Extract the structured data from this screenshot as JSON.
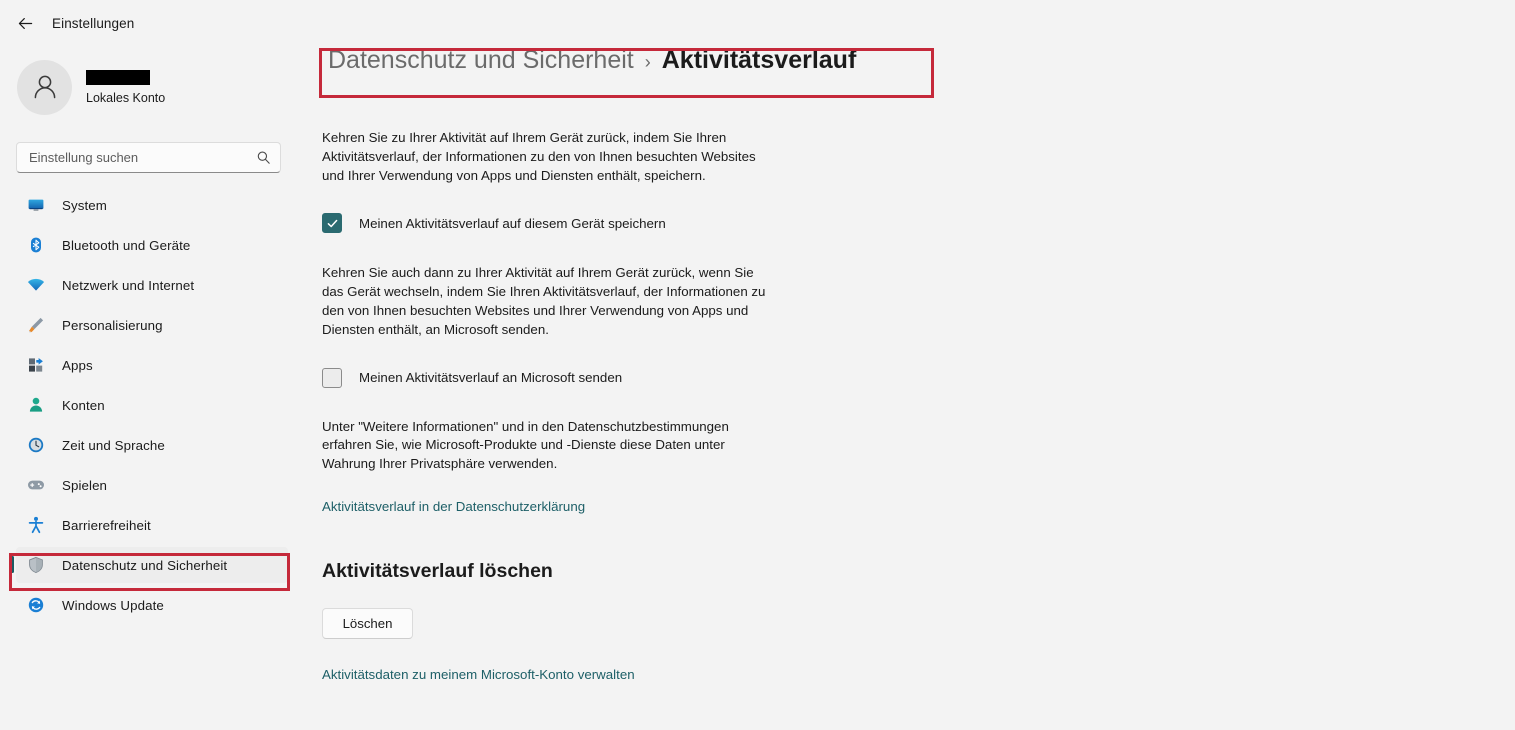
{
  "titlebar": {
    "back_label": "back-arrow",
    "app_title": "Einstellungen"
  },
  "sidebar": {
    "account": {
      "name_redacted": "",
      "account_type": "Lokales Konto"
    },
    "search": {
      "placeholder": "Einstellung suchen",
      "value": ""
    },
    "items": [
      {
        "label": "System",
        "icon": "monitor-icon",
        "selected": false
      },
      {
        "label": "Bluetooth und Geräte",
        "icon": "bluetooth-icon",
        "selected": false
      },
      {
        "label": "Netzwerk und Internet",
        "icon": "wifi-icon",
        "selected": false
      },
      {
        "label": "Personalisierung",
        "icon": "paintbrush-icon",
        "selected": false
      },
      {
        "label": "Apps",
        "icon": "apps-icon",
        "selected": false
      },
      {
        "label": "Konten",
        "icon": "person-icon",
        "selected": false
      },
      {
        "label": "Zeit und Sprache",
        "icon": "clock-icon",
        "selected": false
      },
      {
        "label": "Spielen",
        "icon": "gamepad-icon",
        "selected": false
      },
      {
        "label": "Barrierefreiheit",
        "icon": "accessibility-icon",
        "selected": false
      },
      {
        "label": "Datenschutz und Sicherheit",
        "icon": "shield-icon",
        "selected": true
      },
      {
        "label": "Windows Update",
        "icon": "update-icon",
        "selected": false
      }
    ]
  },
  "main": {
    "breadcrumb": {
      "parent": "Datenschutz und Sicherheit",
      "separator": "›",
      "current": "Aktivitätsverlauf"
    },
    "description_primary": "Kehren Sie zu Ihrer Aktivität auf Ihrem Gerät zurück, indem Sie Ihren Aktivitätsverlauf, der Informationen zu den von Ihnen besuchten Websites und Ihrer Verwendung von Apps und Diensten enthält, speichern.",
    "checkbox_device": {
      "label": "Meinen Aktivitätsverlauf auf diesem Gerät speichern",
      "checked": true
    },
    "description_secondary": "Kehren Sie auch dann zu Ihrer Aktivität auf Ihrem Gerät zurück, wenn Sie das Gerät wechseln, indem Sie Ihren Aktivitätsverlauf, der Informationen zu den von Ihnen besuchten Websites und Ihrer Verwendung von Apps und Diensten enthält, an Microsoft senden.",
    "checkbox_microsoft": {
      "label": "Meinen Aktivitätsverlauf an Microsoft senden",
      "checked": false
    },
    "description_tertiary": "Unter \"Weitere Informationen\" und in den Datenschutzbestimmungen erfahren Sie, wie Microsoft-Produkte und -Dienste diese Daten unter Wahrung Ihrer Privatsphäre verwenden.",
    "privacy_link": "Aktivitätsverlauf in der Datenschutzerklärung",
    "clear_section_title": "Aktivitätsverlauf löschen",
    "clear_button": "Löschen",
    "manage_link": "Aktivitätsdaten zu meinem Microsoft-Konto verwalten"
  },
  "annotations": {
    "highlight_color": "#c5293a",
    "sidebar_highlight_target": "Datenschutz und Sicherheit",
    "header_highlight_target": "Datenschutz und Sicherheit › Aktivitätsverlauf"
  },
  "colors": {
    "page_background": "#f3f3f3",
    "accent_teal": "#2a6a70",
    "link": "#1d5f67",
    "annotation_red": "#c5293a"
  }
}
